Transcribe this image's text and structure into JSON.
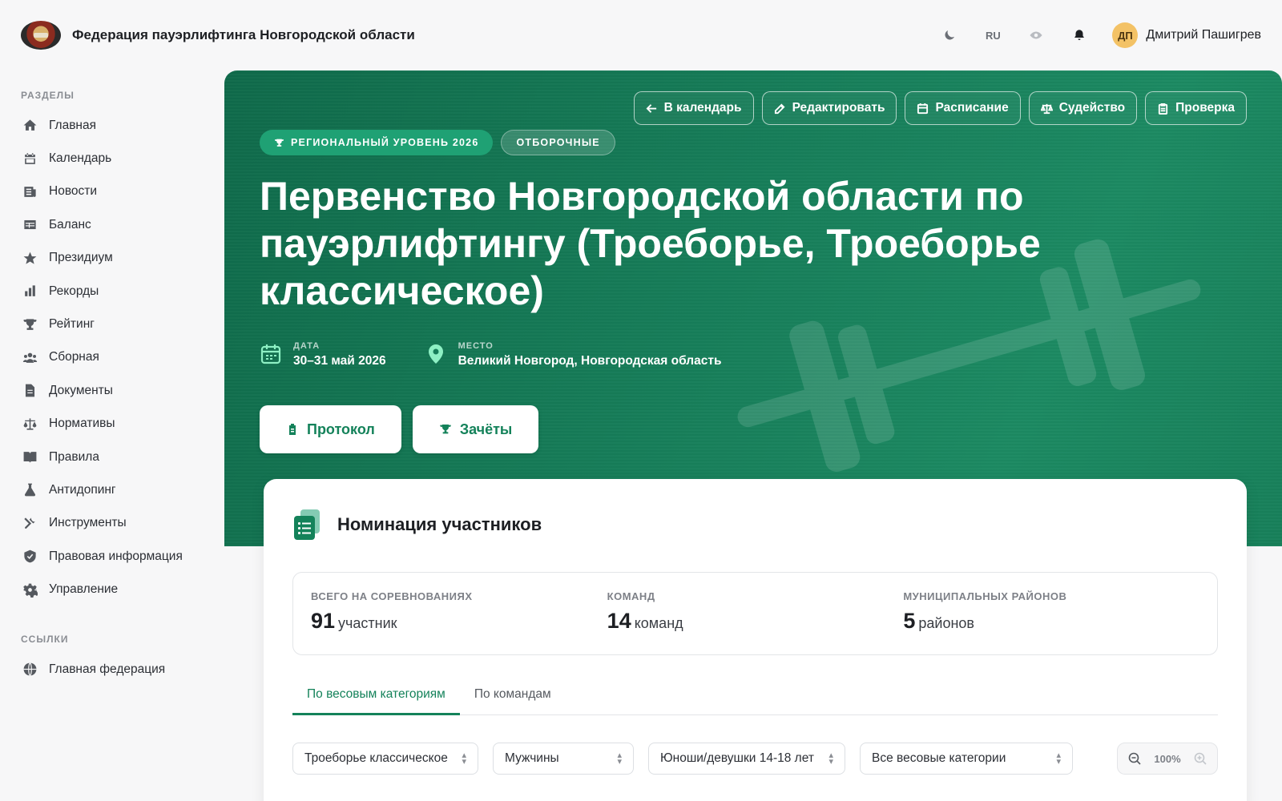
{
  "app": {
    "title": "Федерация пауэрлифтинга Новгородской области",
    "language": "RU",
    "user_initials": "ДП",
    "user_name": "Дмитрий Пашигрев"
  },
  "sidebar": {
    "section_sections": "РАЗДЕЛЫ",
    "items": [
      {
        "label": "Главная",
        "icon": "home-icon"
      },
      {
        "label": "Календарь",
        "icon": "calendar-icon"
      },
      {
        "label": "Новости",
        "icon": "news-icon"
      },
      {
        "label": "Баланс",
        "icon": "table-icon"
      },
      {
        "label": "Президиум",
        "icon": "star-icon"
      },
      {
        "label": "Рекорды",
        "icon": "bar-chart-icon"
      },
      {
        "label": "Рейтинг",
        "icon": "trophy-icon"
      },
      {
        "label": "Сборная",
        "icon": "users-icon"
      },
      {
        "label": "Документы",
        "icon": "document-icon"
      },
      {
        "label": "Нормативы",
        "icon": "scales-icon"
      },
      {
        "label": "Правила",
        "icon": "book-icon"
      },
      {
        "label": "Антидопинг",
        "icon": "flask-icon"
      },
      {
        "label": "Инструменты",
        "icon": "tools-icon"
      },
      {
        "label": "Правовая информация",
        "icon": "shield-icon"
      },
      {
        "label": "Управление",
        "icon": "gear-icon"
      }
    ],
    "section_links": "ССЫЛКИ",
    "links": [
      {
        "label": "Главная федерация",
        "icon": "globe-icon"
      }
    ]
  },
  "hero": {
    "actions": [
      {
        "label": "В календарь",
        "icon": "arrow-left-icon"
      },
      {
        "label": "Редактировать",
        "icon": "edit-icon"
      },
      {
        "label": "Расписание",
        "icon": "calendar-icon"
      },
      {
        "label": "Судейство",
        "icon": "scales-icon"
      },
      {
        "label": "Проверка",
        "icon": "clipboard-icon"
      }
    ],
    "badge_level": "РЕГИОНАЛЬНЫЙ УРОВЕНЬ 2026",
    "badge_stage": "ОТБОРОЧНЫЕ",
    "title": "Первенство Новгородской области по пауэрлифтингу (Троеборье, Троеборье классическое)",
    "date_label": "ДАТА",
    "date_value": "30–31 май 2026",
    "place_label": "МЕСТО",
    "place_value": "Великий Новгород, Новгородская область",
    "protocol_label": "Протокол",
    "credits_label": "Зачёты"
  },
  "card": {
    "title": "Номинация участников",
    "stats": [
      {
        "label": "ВСЕГО НА СОРЕВНОВАНИЯХ",
        "value": "91",
        "unit": "участник"
      },
      {
        "label": "КОМАНД",
        "value": "14",
        "unit": "команд"
      },
      {
        "label": "МУНИЦИПАЛЬНЫХ РАЙОНОВ",
        "value": "5",
        "unit": "районов"
      }
    ],
    "tabs": [
      {
        "label": "По весовым категориям",
        "active": true
      },
      {
        "label": "По командам",
        "active": false
      }
    ],
    "filters": {
      "discipline": "Троеборье классическое",
      "gender": "Мужчины",
      "age": "Юноши/девушки 14-18 лет",
      "weight": "Все весовые категории"
    },
    "zoom": "100%"
  },
  "colors": {
    "brand_green": "#14825a",
    "hero_dark": "#0f6a4a",
    "badge_green": "#1fa174",
    "avatar": "#f3c266"
  }
}
